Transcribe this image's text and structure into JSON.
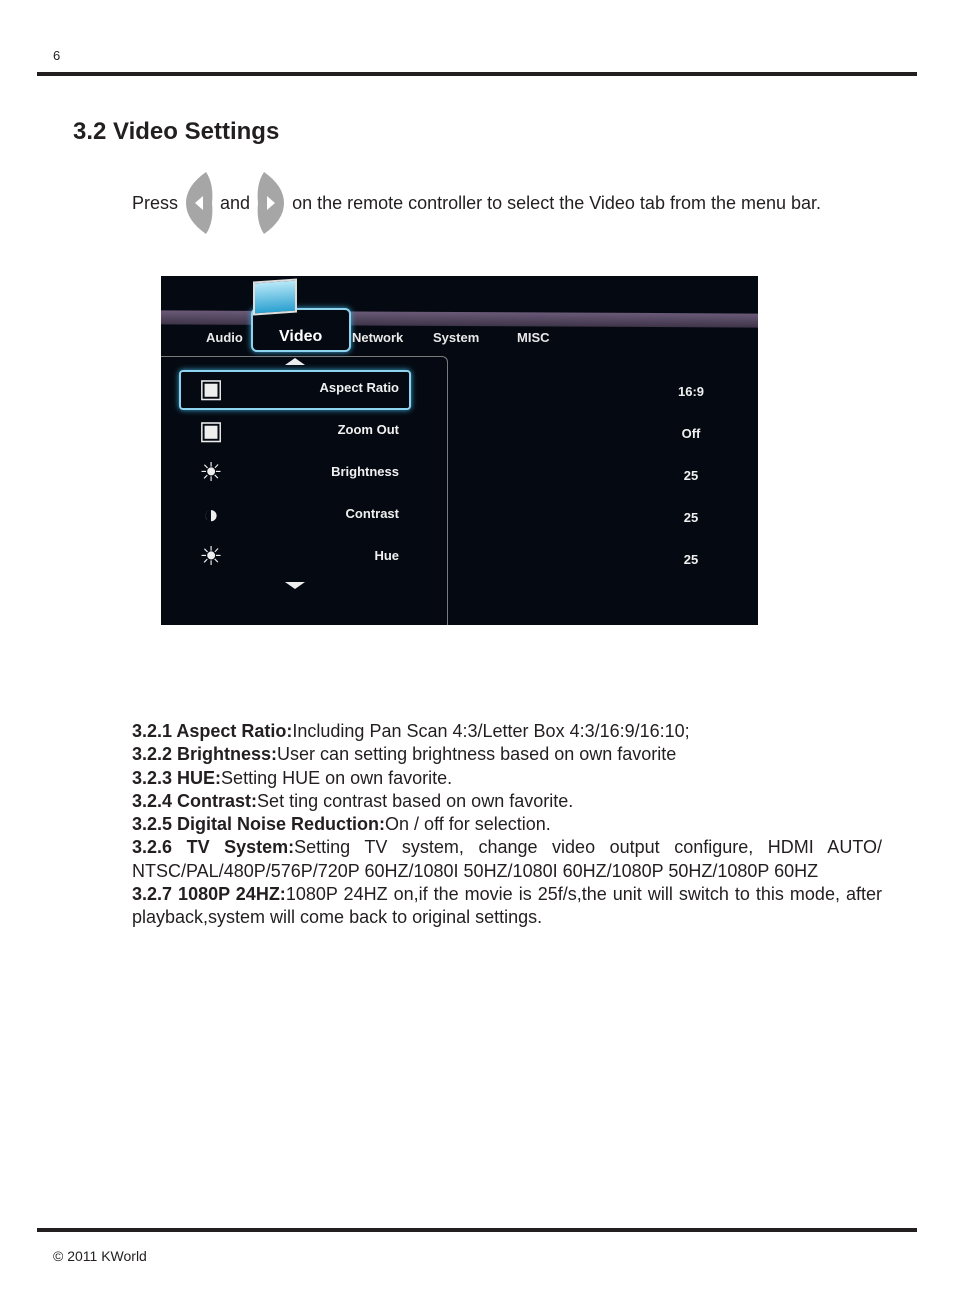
{
  "page_number": "6",
  "heading": "3.2 Video Settings",
  "instruction": {
    "before": "Press",
    "middle": "and",
    "after": "on the remote controller to select the Video tab from the menu bar.",
    "left_key_icon": "left-arrow-key",
    "right_key_icon": "right-arrow-key",
    "key_color": "#a6a6a6"
  },
  "screenshot": {
    "tabs": [
      "Audio",
      "Video",
      "Network",
      "System",
      "MISC"
    ],
    "active_tab": "Video",
    "items": [
      {
        "label": "Aspect Ratio",
        "value": "16:9",
        "icon": "aspect-ratio-icon",
        "selected": true
      },
      {
        "label": "Zoom Out",
        "value": "Off",
        "icon": "zoom-out-icon",
        "selected": false
      },
      {
        "label": "Brightness",
        "value": "25",
        "icon": "sun-icon",
        "selected": false
      },
      {
        "label": "Contrast",
        "value": "25",
        "icon": "contrast-icon",
        "selected": false
      },
      {
        "label": "Hue",
        "value": "25",
        "icon": "sun-icon",
        "selected": false
      }
    ],
    "highlight_color": "#8fd4ef"
  },
  "descriptions": [
    {
      "term": "3.2.1 Aspect Ratio:",
      "text": "Including Pan Scan 4:3/Letter Box 4:3/16:9/16:10;"
    },
    {
      "term": "3.2.2 Brightness:",
      "text": "User can setting brightness based on own favorite"
    },
    {
      "term": "3.2.3 HUE:",
      "text": "Setting HUE on own favorite."
    },
    {
      "term": "3.2.4 Contrast:",
      "text": "Set ting contrast based on own favorite."
    },
    {
      "term": "3.2.5 Digital Noise Reduction:",
      "text": "On / off for selection."
    },
    {
      "term": "3.2.6 TV System:",
      "text": "Setting TV system, change video output configure, HDMI AUTO/ NTSC/PAL/480P/576P/720P 60HZ/1080I 50HZ/1080I 60HZ/1080P 50HZ/1080P 60HZ"
    },
    {
      "term": "3.2.7 1080P 24HZ:",
      "text": "1080P 24HZ on,if the movie is 25f/s,the unit will switch to this mode, after playback,system will come back to original settings."
    }
  ],
  "footer": "© 2011 KWorld"
}
